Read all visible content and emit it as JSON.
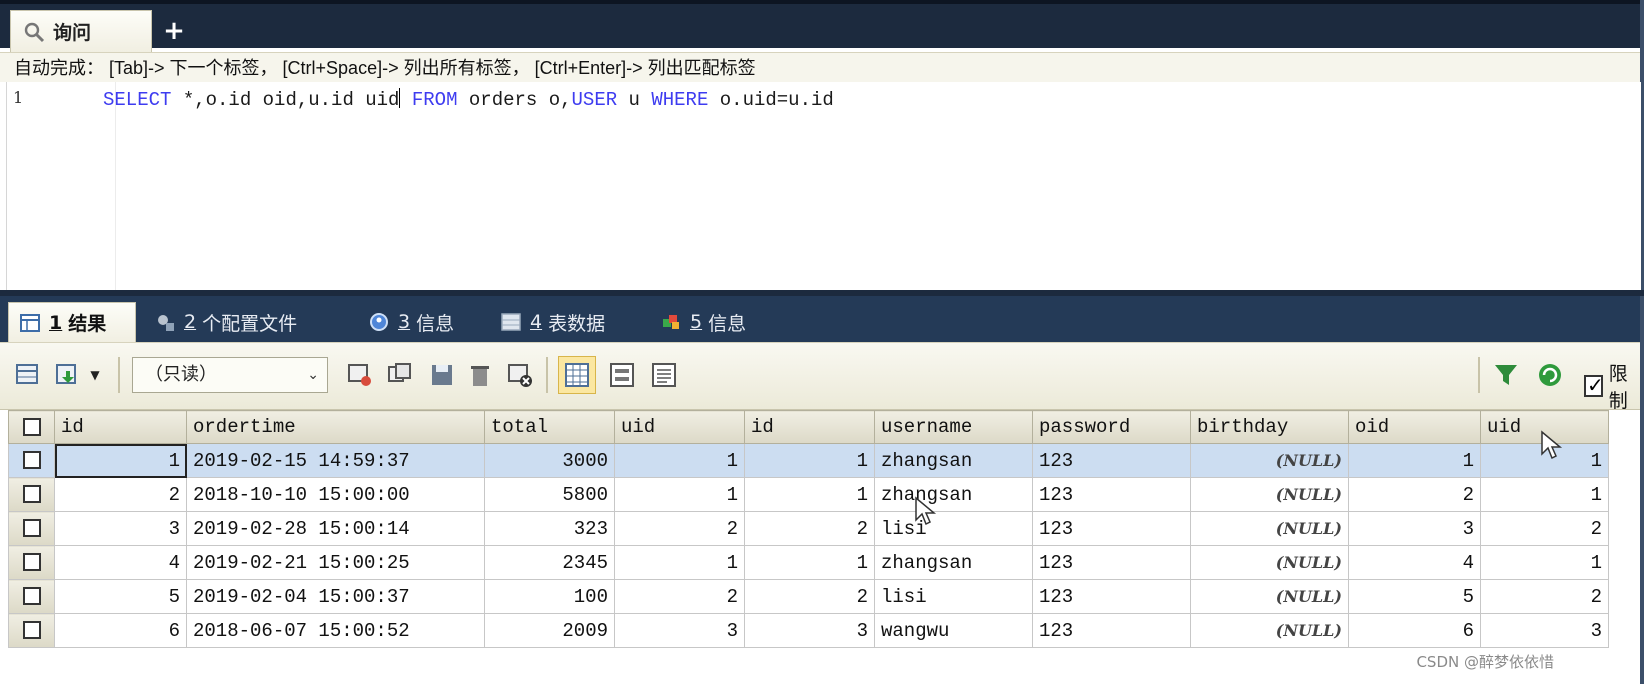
{
  "query_tab": {
    "label": "询问",
    "add_label": "+"
  },
  "editor": {
    "hint": "自动完成：  [Tab]-> 下一个标签，  [Ctrl+Space]-> 列出所有标签，  [Ctrl+Enter]-> 列出匹配标签",
    "line_number": "1",
    "sql": {
      "kw_select": "SELECT",
      "part1": " *,o.id oid,u.id uid",
      "kw_from": "FROM",
      "part2": " orders o,",
      "kw_user": "USER",
      "part3": " u ",
      "kw_where": "WHERE",
      "part4": " o.uid=u.id"
    }
  },
  "result_tabs": [
    {
      "num": "1",
      "label": "结果"
    },
    {
      "num": "2",
      "label": "个配置文件"
    },
    {
      "num": "3",
      "label": "信息"
    },
    {
      "num": "4",
      "label": "表数据"
    },
    {
      "num": "5",
      "label": "信息"
    }
  ],
  "toolbar": {
    "mode_select": "（只读）",
    "limit_label": "限制"
  },
  "columns": [
    "id",
    "ordertime",
    "total",
    "uid",
    "id",
    "username",
    "password",
    "birthday",
    "oid",
    "uid"
  ],
  "rows": [
    [
      "1",
      "2019-02-15 14:59:37",
      "3000",
      "1",
      "1",
      "zhangsan",
      "123",
      "(NULL)",
      "1",
      "1"
    ],
    [
      "2",
      "2018-10-10 15:00:00",
      "5800",
      "1",
      "1",
      "zhangsan",
      "123",
      "(NULL)",
      "2",
      "1"
    ],
    [
      "3",
      "2019-02-28 15:00:14",
      "323",
      "2",
      "2",
      "lisi",
      "123",
      "(NULL)",
      "3",
      "2"
    ],
    [
      "4",
      "2019-02-21 15:00:25",
      "2345",
      "1",
      "1",
      "zhangsan",
      "123",
      "(NULL)",
      "4",
      "1"
    ],
    [
      "5",
      "2019-02-04 15:00:37",
      "100",
      "2",
      "2",
      "lisi",
      "123",
      "(NULL)",
      "5",
      "2"
    ],
    [
      "6",
      "2018-06-07 15:00:52",
      "2009",
      "3",
      "3",
      "wangwu",
      "123",
      "(NULL)",
      "6",
      "3"
    ]
  ],
  "selected_row": 0,
  "watermark": "CSDN @醉梦依依惜",
  "colors": {
    "chrome_dark": "#1c2a3e",
    "tab_bar": "#243a57",
    "keyword": "#3e3cf0",
    "selection": "#ccddf1"
  }
}
